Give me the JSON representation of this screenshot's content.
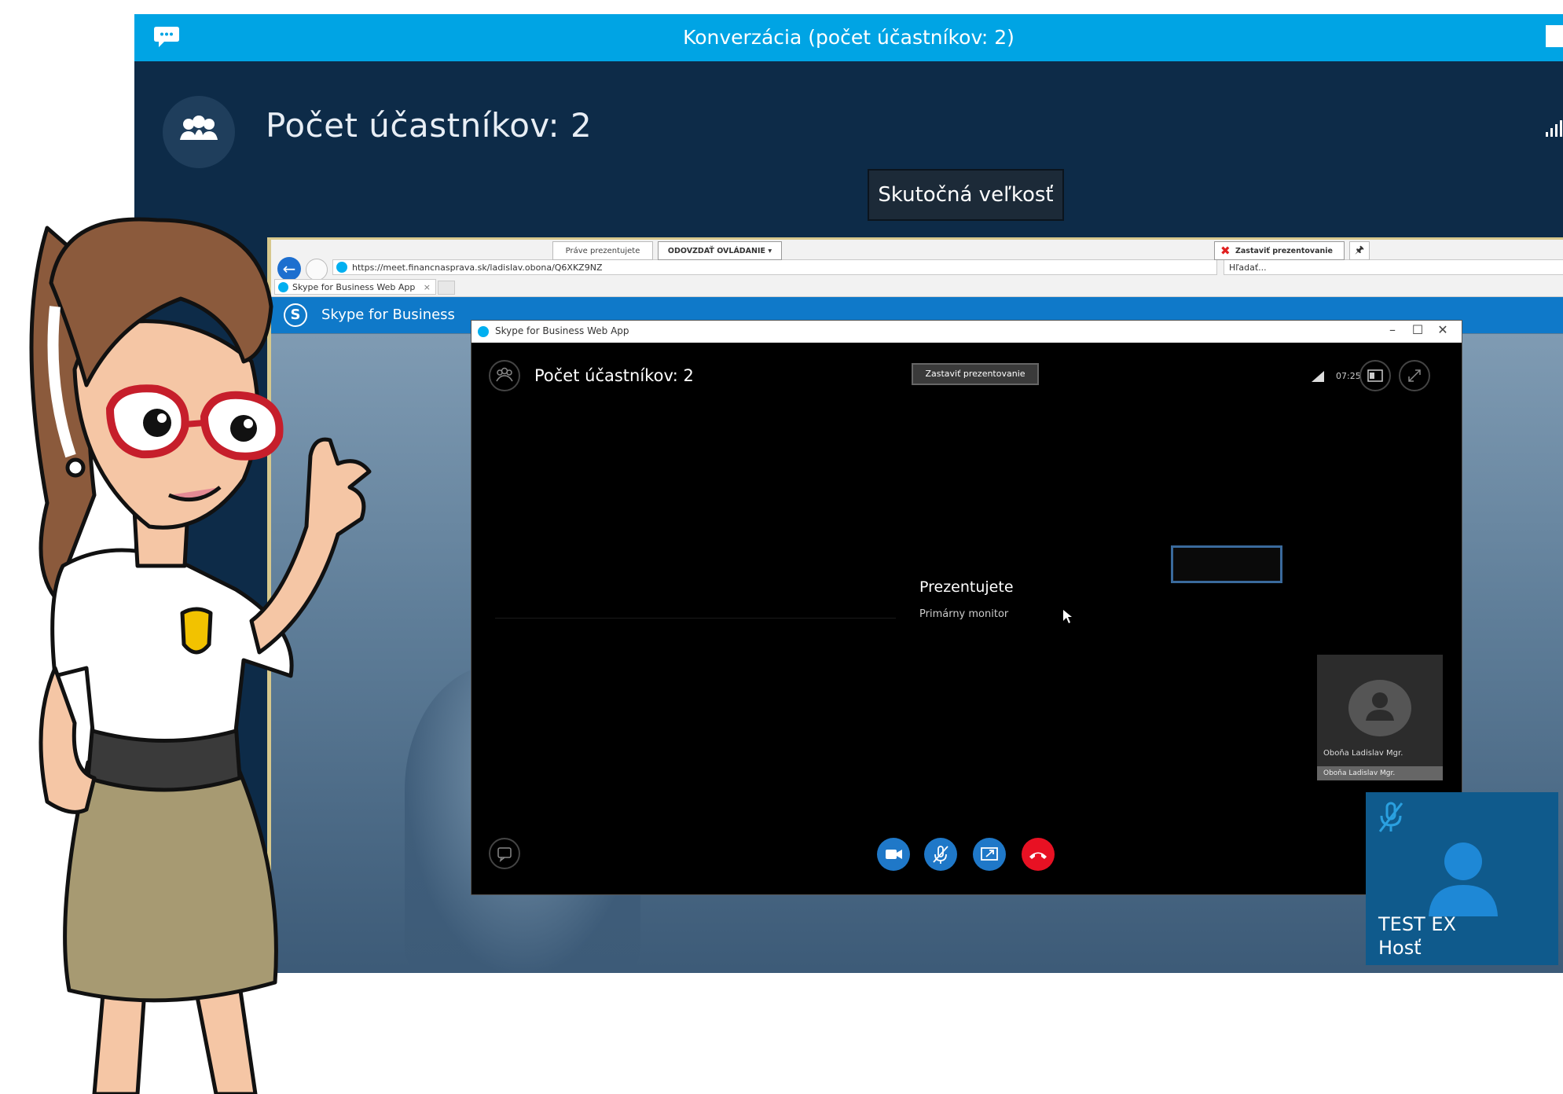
{
  "window": {
    "title": "Konverzácia (počet účastníkov: 2)"
  },
  "header": {
    "participants_title": "Počet účastníkov: 2",
    "tooltip": "Skutočná veľkosť"
  },
  "browser": {
    "address": "https://meet.financnasprava.sk/ladislav.obona/Q6XKZ9NZ",
    "search_placeholder": "Hľadať...",
    "tab_label": "Skype for Business Web App",
    "tab_close": "×",
    "presenting_label": "Práve prezentujete",
    "give_control": "ODOVZDAŤ OVLÁDANIE ▾",
    "stop_presenting": "Zastaviť prezentovanie",
    "pin": "🖈"
  },
  "webapp": {
    "brand": "Skype for Business",
    "logo_letter": "S",
    "window_title": "Skype for Business Web App",
    "participants_title": "Počet účastníkov: 2",
    "stop_presenting": "Zastaviť prezentovanie",
    "time": "07:25",
    "presenting": "Prezentujete",
    "monitor": "Primárny monitor",
    "tile_name": "Oboňa Ladislav Mgr.",
    "tile_bar": "Oboňa Ladislav Mgr."
  },
  "guest": {
    "name": "TEST EX",
    "role": "Hosť"
  },
  "colors": {
    "accent": "#00a4e4",
    "dark": "#0d2b48",
    "hangup": "#e81123",
    "button": "#1f78c8"
  }
}
